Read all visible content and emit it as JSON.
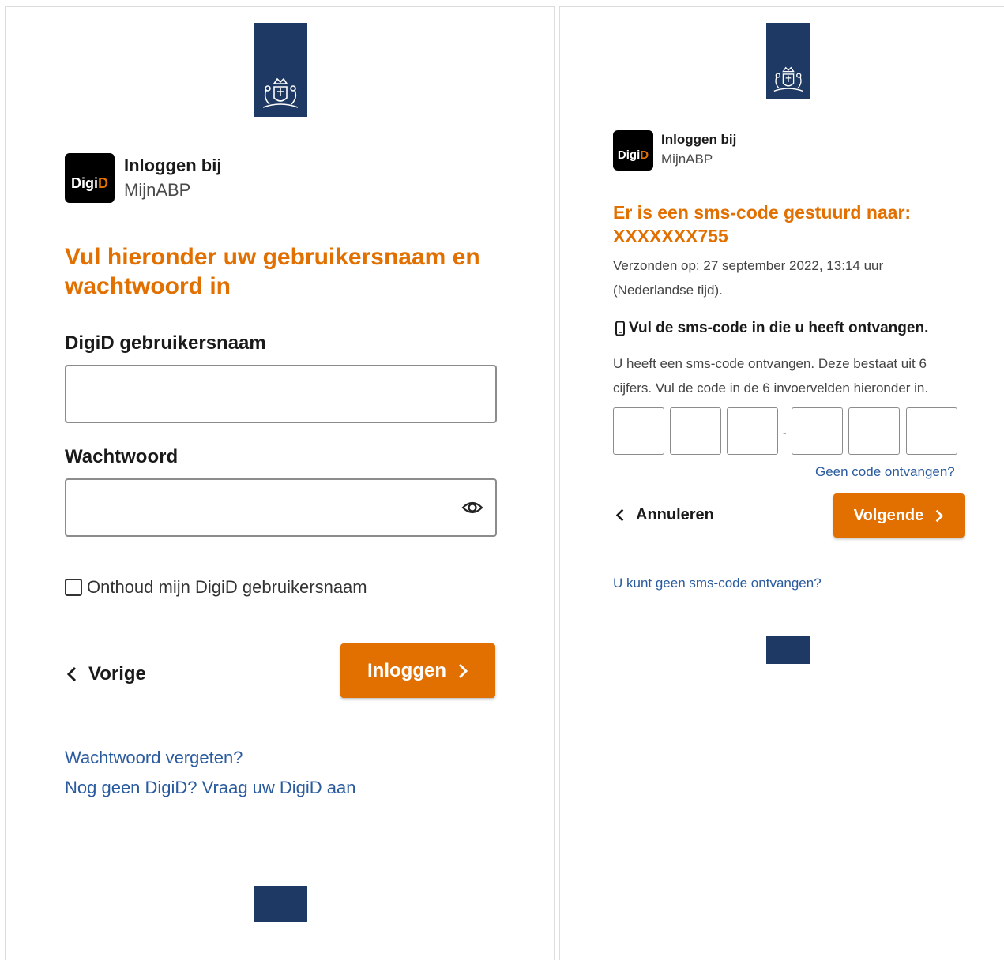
{
  "left": {
    "login_to": "Inloggen bij",
    "app_name": "MijnABP",
    "digid_badge": {
      "part1": "Digi",
      "part2": "D"
    },
    "heading_line1": "Vul hieronder uw gebruikersnaam en",
    "heading_line2": "wachtwoord in",
    "username_label": "DigiD gebruikersnaam",
    "username_value": "",
    "password_label": "Wachtwoord",
    "password_value": "",
    "remember_label": "Onthoud mijn DigiD gebruikersnaam",
    "back_label": "Vorige",
    "login_button": "Inloggen",
    "forgot_password": "Wachtwoord vergeten?",
    "no_digid": "Nog geen DigiD? Vraag uw DigiD aan"
  },
  "right": {
    "login_to": "Inloggen bij",
    "app_name": "MijnABP",
    "digid_badge": {
      "part1": "Digi",
      "part2": "D"
    },
    "heading_line1": "Er is een sms-code gestuurd naar:",
    "heading_line2": "XXXXXXX755",
    "sent_line1": "Verzonden op: 27 september 2022, 13:14 uur",
    "sent_line2": "(Nederlandse tijd).",
    "instruction": "Vul de sms-code in die u heeft ontvangen.",
    "help_line1": "U heeft een sms-code ontvangen. Deze bestaat uit 6",
    "help_line2": "cijfers. Vul de code in de 6 invoervelden hieronder in.",
    "code_separator": "-",
    "no_code": "Geen code ontvangen?",
    "cancel_label": "Annuleren",
    "next_button": "Volgende",
    "cannot_receive": "U kunt geen sms-code ontvangen?"
  },
  "icons": {
    "logo": "rijksoverheid-emblem-icon",
    "eye": "eye-icon",
    "chevron_left": "chevron-left-icon",
    "chevron_right": "chevron-right-icon",
    "phone": "mobile-phone-icon"
  },
  "colors": {
    "brand_orange": "#e17000",
    "brand_blue": "#1e3a64",
    "link_blue": "#2a5b9e"
  }
}
